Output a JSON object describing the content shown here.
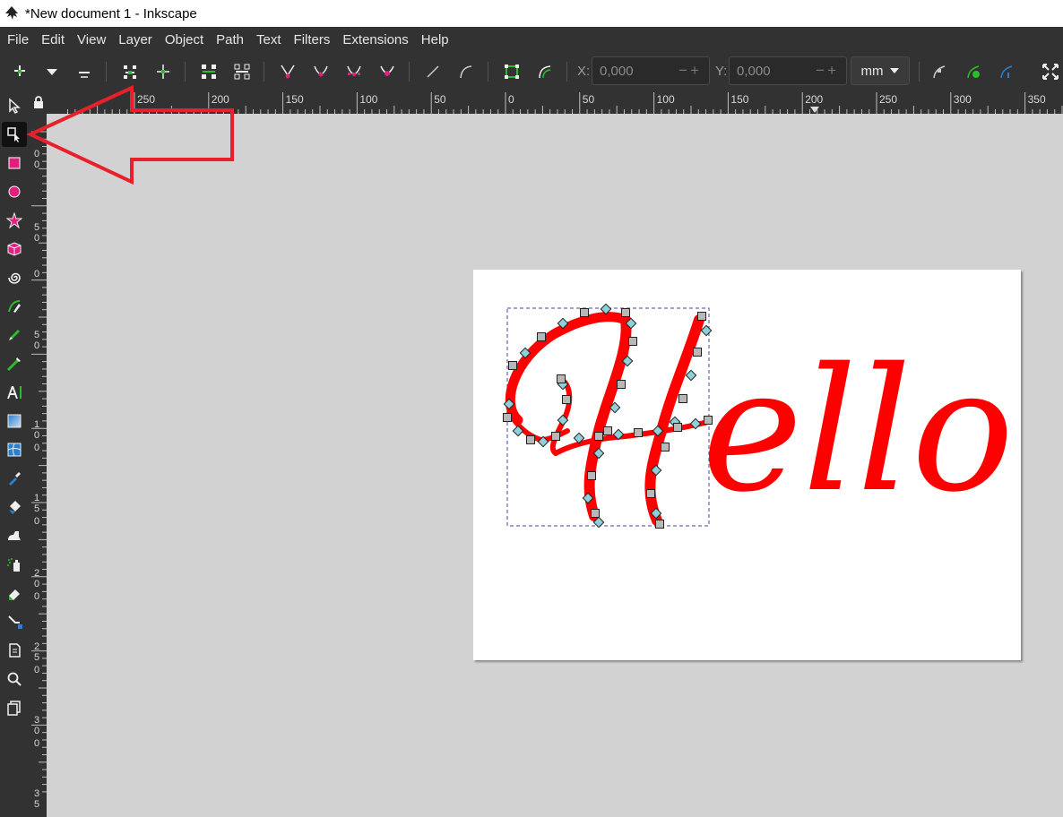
{
  "window": {
    "title": "*New document 1 - Inkscape"
  },
  "menu": {
    "items": [
      "File",
      "Edit",
      "View",
      "Layer",
      "Object",
      "Path",
      "Text",
      "Filters",
      "Extensions",
      "Help"
    ]
  },
  "toolbar": {
    "x_label": "X:",
    "x_value": "0,000",
    "y_label": "Y:",
    "y_value": "0,000",
    "unit": "mm"
  },
  "ruler": {
    "h_labels": [
      "250",
      "200",
      "150",
      "100",
      "50",
      "0",
      "50",
      "100",
      "150",
      "200",
      "250",
      "300",
      "350"
    ],
    "v_labels": [
      "0",
      "0",
      "5",
      "0",
      "0",
      "5",
      "0",
      "1",
      "0",
      "0",
      "1",
      "5",
      "0",
      "2",
      "0",
      "0",
      "2",
      "5",
      "0",
      "3",
      "0",
      "0",
      "3",
      "5"
    ]
  },
  "tools": {
    "active": "node-tool"
  },
  "document": {
    "text": "Hello",
    "text_color": "#ff0000"
  },
  "annotation": {
    "arrow_color": "#e8202a"
  }
}
